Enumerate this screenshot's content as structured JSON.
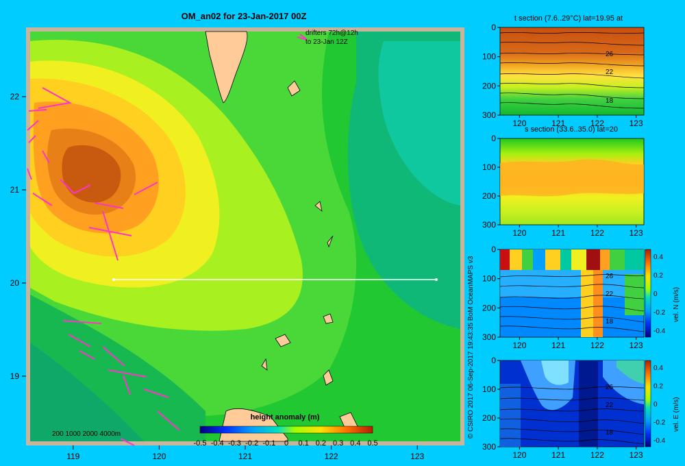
{
  "colors": {
    "background": "#00ccff",
    "frame": "#c8b49c",
    "land": "#ffcc99",
    "drifter": "#ff33cc",
    "section_line": "#ffffff"
  },
  "map": {
    "title": "OM_an02 for 23-Jan-2017 00Z",
    "drifters_note_line1": "drifters 72h@12h",
    "drifters_note_line2": "to 23-Jan 12Z",
    "depth_legend": "200  1000  2000  4000m",
    "colorbar_title": "height anomaly  (m)",
    "colorbar_ticks": [
      "-0.5",
      "-0.4",
      "-0.3",
      "-0.2",
      "-0.1",
      "0",
      "0.1",
      "0.2",
      "0.3",
      "0.4",
      "0.5"
    ],
    "x_ticks": [
      "119",
      "120",
      "121",
      "122",
      "123"
    ],
    "y_ticks": [
      "22",
      "21",
      "20",
      "19"
    ]
  },
  "credit": "© CSIRO 2017   06-Sep-2017 19:43:35 BoM OceanMAPS v3",
  "panels": [
    {
      "title": "t section (7.6..29°C) lat=19.95 at",
      "contours": [
        "26",
        "22",
        "18"
      ],
      "colorbar": null
    },
    {
      "title": "s section (33.6..35.0) lat=20",
      "contours": [],
      "colorbar": null
    },
    {
      "title": "",
      "contours": [
        "26",
        "22",
        "18"
      ],
      "colorbar": {
        "label": "vel. N  (m/s)",
        "ticks": [
          "0.4",
          "0.2",
          "0",
          "-0.2",
          "-0.4"
        ]
      }
    },
    {
      "title": "",
      "contours": [
        "26",
        "22",
        "18"
      ],
      "colorbar": {
        "label": "vel. E  (m/s)",
        "ticks": [
          "0.4",
          "0.2",
          "0",
          "-0.2",
          "-0.4"
        ]
      }
    }
  ],
  "panel_axes": {
    "x_ticks": [
      "120",
      "121",
      "122",
      "123"
    ],
    "y_ticks": [
      "0",
      "100",
      "200",
      "300"
    ]
  },
  "chart_data": [
    {
      "type": "heatmap",
      "title": "OM_an02 for 23-Jan-2017 00Z",
      "xlim": [
        118.5,
        123.5
      ],
      "ylim": [
        18.3,
        22.7
      ],
      "x_ticks": [
        119,
        120,
        121,
        122,
        123
      ],
      "y_ticks": [
        19,
        20,
        21,
        22
      ],
      "colorbar": {
        "label": "height anomaly  (m)",
        "range": [
          -0.5,
          0.5
        ]
      },
      "section_line": {
        "lat": 20.0,
        "lon": [
          119.5,
          123.2
        ]
      },
      "features": [
        {
          "name": "warm eddy",
          "center_lon": 119.3,
          "center_lat": 21.1,
          "peak_value": 0.4
        }
      ]
    },
    {
      "type": "heatmap",
      "title": "t section (7.6..29°C) lat=19.95 at",
      "xlim": [
        119.5,
        123.2
      ],
      "ylim": [
        300,
        0
      ],
      "contours": [
        26,
        22,
        18
      ]
    },
    {
      "type": "heatmap",
      "title": "s section (33.6..35.0) lat=20",
      "xlim": [
        119.5,
        123.2
      ],
      "ylim": [
        300,
        0
      ]
    },
    {
      "type": "heatmap",
      "xlim": [
        119.5,
        123.2
      ],
      "ylim": [
        300,
        0
      ],
      "contours": [
        26,
        22,
        18
      ],
      "colorbar": {
        "label": "vel. N  (m/s)",
        "range": [
          -0.4,
          0.4
        ]
      }
    },
    {
      "type": "heatmap",
      "xlim": [
        119.5,
        123.2
      ],
      "ylim": [
        300,
        0
      ],
      "contours": [
        26,
        22,
        18
      ],
      "colorbar": {
        "label": "vel. E  (m/s)",
        "range": [
          -0.4,
          0.4
        ]
      }
    }
  ]
}
